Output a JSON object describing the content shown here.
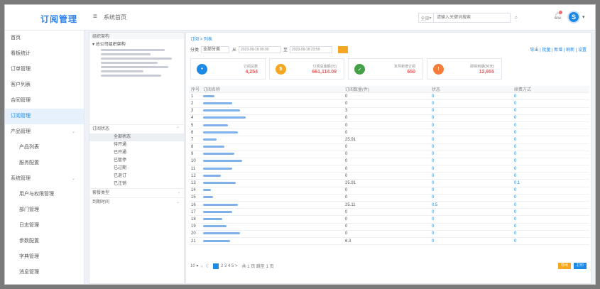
{
  "header": {
    "logo": "订阅管理",
    "menu_icon": "≡",
    "title": "系统首页",
    "search_select": "全部",
    "search_placeholder": "请输入关键词搜索",
    "avatar_initial": "S"
  },
  "sidebar": {
    "items": [
      {
        "label": "首页",
        "sub": false,
        "active": false
      },
      {
        "label": "看板统计",
        "sub": false,
        "active": false
      },
      {
        "label": "订单管理",
        "sub": false,
        "active": false
      },
      {
        "label": "客户列表",
        "sub": false,
        "active": false
      },
      {
        "label": "合同管理",
        "sub": false,
        "active": false
      },
      {
        "label": "订阅管理",
        "sub": false,
        "active": true
      },
      {
        "label": "产品管理",
        "sub": false,
        "active": false,
        "caret": true
      },
      {
        "label": "产品列表",
        "sub": true,
        "active": false
      },
      {
        "label": "服务配置",
        "sub": true,
        "active": false
      },
      {
        "label": "系统管理",
        "sub": false,
        "active": false,
        "caret": true
      },
      {
        "label": "用户与权限管理",
        "sub": true,
        "active": false
      },
      {
        "label": "部门管理",
        "sub": true,
        "active": false
      },
      {
        "label": "日志管理",
        "sub": true,
        "active": false
      },
      {
        "label": "参数配置",
        "sub": true,
        "active": false
      },
      {
        "label": "字典管理",
        "sub": true,
        "active": false
      },
      {
        "label": "消息管理",
        "sub": true,
        "active": false
      }
    ]
  },
  "org": {
    "head": "组织架构",
    "root": "总公司组织架构",
    "section1": "订阅状态",
    "filters": [
      "全部状态",
      "待开通",
      "已开通",
      "已暂停",
      "已过期",
      "已退订",
      "已注销"
    ],
    "section2": "套餐类型",
    "section3": "到期时间"
  },
  "main": {
    "breadcrumb": "订阅 > 列表",
    "filter_label": "分类",
    "filter_select": "全部分类",
    "from_label": "从",
    "from_date": "2023-09-18 00:00",
    "to_label": "至",
    "to_date": "2023-09-18 23:59",
    "toolbar_links": "导出 | 批量 | 新增 | 刷新 | 设置",
    "cards": [
      {
        "label": "订阅总数",
        "value": "4,254",
        "color": "#1e88e5",
        "icon": "•"
      },
      {
        "label": "订阅总金额(元)",
        "value": "661,114.09",
        "color": "#f5a623",
        "icon": "$"
      },
      {
        "label": "本月新增订阅",
        "value": "650",
        "color": "#43a047",
        "icon": "✓"
      },
      {
        "label": "即将到期(30天)",
        "value": "12,955",
        "color": "#f57c3a",
        "icon": "!"
      }
    ],
    "columns": [
      "序号",
      "订阅名称",
      "订阅数量(件)",
      "状态",
      "续费方式"
    ],
    "rows": [
      {
        "idx": "1",
        "name_w": 12,
        "cnt": "0",
        "a": "0",
        "b": "0"
      },
      {
        "idx": "2",
        "name_w": 30,
        "cnt": "0",
        "a": "0",
        "b": "0"
      },
      {
        "idx": "3",
        "name_w": 38,
        "cnt": "3",
        "a": "0",
        "b": "0"
      },
      {
        "idx": "4",
        "name_w": 44,
        "cnt": "0",
        "a": "0",
        "b": "0"
      },
      {
        "idx": "5",
        "name_w": 26,
        "cnt": "0",
        "a": "0",
        "b": "0"
      },
      {
        "idx": "6",
        "name_w": 36,
        "cnt": "0",
        "a": "0",
        "b": "0"
      },
      {
        "idx": "7",
        "name_w": 14,
        "cnt": "25.91",
        "a": "0",
        "b": "0"
      },
      {
        "idx": "8",
        "name_w": 22,
        "cnt": "0",
        "a": "0",
        "b": "0"
      },
      {
        "idx": "9",
        "name_w": 32,
        "cnt": "0",
        "a": "0",
        "b": "0"
      },
      {
        "idx": "10",
        "name_w": 40,
        "cnt": "0",
        "a": "0",
        "b": "0"
      },
      {
        "idx": "11",
        "name_w": 30,
        "cnt": "0",
        "a": "0",
        "b": "0"
      },
      {
        "idx": "12",
        "name_w": 18,
        "cnt": "0",
        "a": "0",
        "b": "0"
      },
      {
        "idx": "13",
        "name_w": 34,
        "cnt": "25.91",
        "a": "0",
        "b": "0.1"
      },
      {
        "idx": "14",
        "name_w": 8,
        "cnt": "0",
        "a": "0",
        "b": "0"
      },
      {
        "idx": "15",
        "name_w": 10,
        "cnt": "0",
        "a": "0",
        "b": "0"
      },
      {
        "idx": "16",
        "name_w": 36,
        "cnt": "25.11",
        "a": "0.5",
        "b": "0"
      },
      {
        "idx": "17",
        "name_w": 30,
        "cnt": "0",
        "a": "0",
        "b": "0"
      },
      {
        "idx": "18",
        "name_w": 20,
        "cnt": "0",
        "a": "0",
        "b": "0"
      },
      {
        "idx": "19",
        "name_w": 24,
        "cnt": "0",
        "a": "0",
        "b": "0"
      },
      {
        "idx": "20",
        "name_w": 38,
        "cnt": "0",
        "a": "0",
        "b": "0"
      },
      {
        "idx": "21",
        "name_w": 28,
        "cnt": "6.3",
        "a": "0",
        "b": "0"
      }
    ],
    "pager_size": "10 ▾",
    "pager_pages": "2 3 4 5 >",
    "pager_info": "共 1 页  跳至  1  页",
    "btn_export": "导出",
    "btn_print": "打印"
  }
}
